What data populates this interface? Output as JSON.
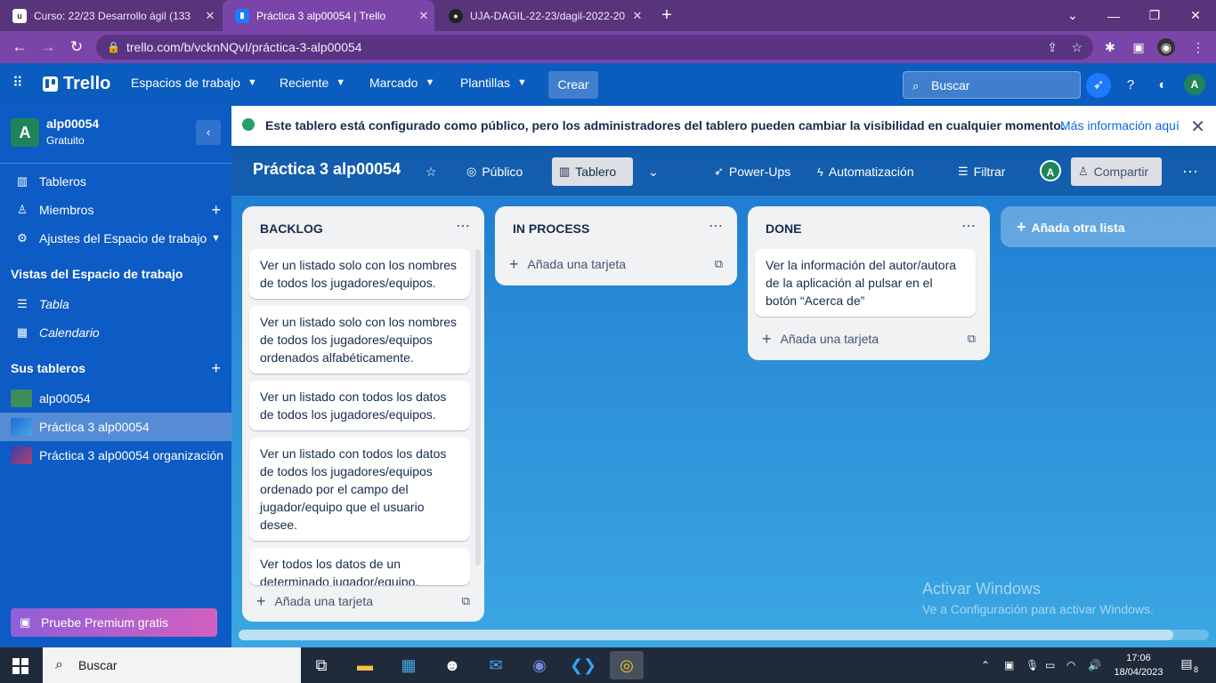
{
  "browser": {
    "tabs": [
      {
        "title": "Curso: 22/23 Desarrollo ágil (133",
        "favicon": "uja"
      },
      {
        "title": "Práctica 3 alp00054 | Trello",
        "favicon": "trello-icon"
      },
      {
        "title": "UJA-DAGIL-22-23/dagil-2022-20",
        "favicon": "github-icon"
      }
    ],
    "url": "trello.com/b/vcknNQvI/práctica-3-alp00054",
    "window_controls": [
      "chevron-down-icon",
      "minimize-icon",
      "restore-icon",
      "close-icon"
    ]
  },
  "header": {
    "logo": "Trello",
    "menus": [
      "Espacios de trabajo",
      "Reciente",
      "Marcado",
      "Plantillas"
    ],
    "create_label": "Crear",
    "search_placeholder": "Buscar",
    "avatar_initial": "A"
  },
  "sidebar": {
    "workspace_initial": "A",
    "workspace_name": "alp00054",
    "workspace_plan": "Gratuito",
    "nav": [
      {
        "label": "Tableros",
        "icon": "board-icon"
      },
      {
        "label": "Miembros",
        "icon": "person-icon"
      },
      {
        "label": "Ajustes del Espacio de trabajo",
        "icon": "gear-icon"
      }
    ],
    "views_heading": "Vistas del Espacio de trabajo",
    "views": [
      {
        "label": "Tabla",
        "icon": "table-icon"
      },
      {
        "label": "Calendario",
        "icon": "calendar-icon"
      }
    ],
    "boards_heading": "Sus tableros",
    "boards": [
      {
        "label": "alp00054",
        "color": "#3b8d5c"
      },
      {
        "label": "Práctica 3 alp00054",
        "color": "#2f7fe0"
      },
      {
        "label": "Práctica 3 alp00054 organización",
        "color": "#6b3fa0"
      }
    ],
    "premium_label": "Pruebe Premium gratis"
  },
  "banner": {
    "text": "Este tablero está configurado como público, pero los administradores del tablero pueden cambiar la visibilidad en cualquier momento.",
    "link": "Más información aquí"
  },
  "board": {
    "title": "Práctica 3 alp00054",
    "visibility": "Público",
    "view": "Tablero",
    "powerups": "Power-Ups",
    "automation": "Automatización",
    "filter": "Filtrar",
    "share": "Compartir",
    "add_card_label": "Añada una tarjeta",
    "add_list_label": "Añada otra lista",
    "lists": [
      {
        "title": "BACKLOG",
        "cards": [
          "Ver un listado solo con los nombres de todos los jugadores/equipos.",
          "Ver un listado solo con los nombres de todos los jugadores/equipos ordenados alfabéticamente.",
          "Ver un listado con todos los datos de todos los jugadores/equipos.",
          "Ver un listado con todos los datos de todos los jugadores/equipos ordenado por el campo del jugador/equipo que el usuario desee.",
          "Ver todos los datos de un determinado jugador/equipo."
        ]
      },
      {
        "title": "IN PROCESS",
        "cards": []
      },
      {
        "title": "DONE",
        "cards": [
          "Ver la información del autor/autora de la aplicación al pulsar en el botón “Acerca de”"
        ]
      }
    ]
  },
  "watermark": {
    "line1": "Activar Windows",
    "line2": "Ve a Configuración para activar Windows."
  },
  "taskbar": {
    "search_placeholder": "Buscar",
    "time": "17:06",
    "date": "18/04/2023",
    "notifications": "8"
  }
}
